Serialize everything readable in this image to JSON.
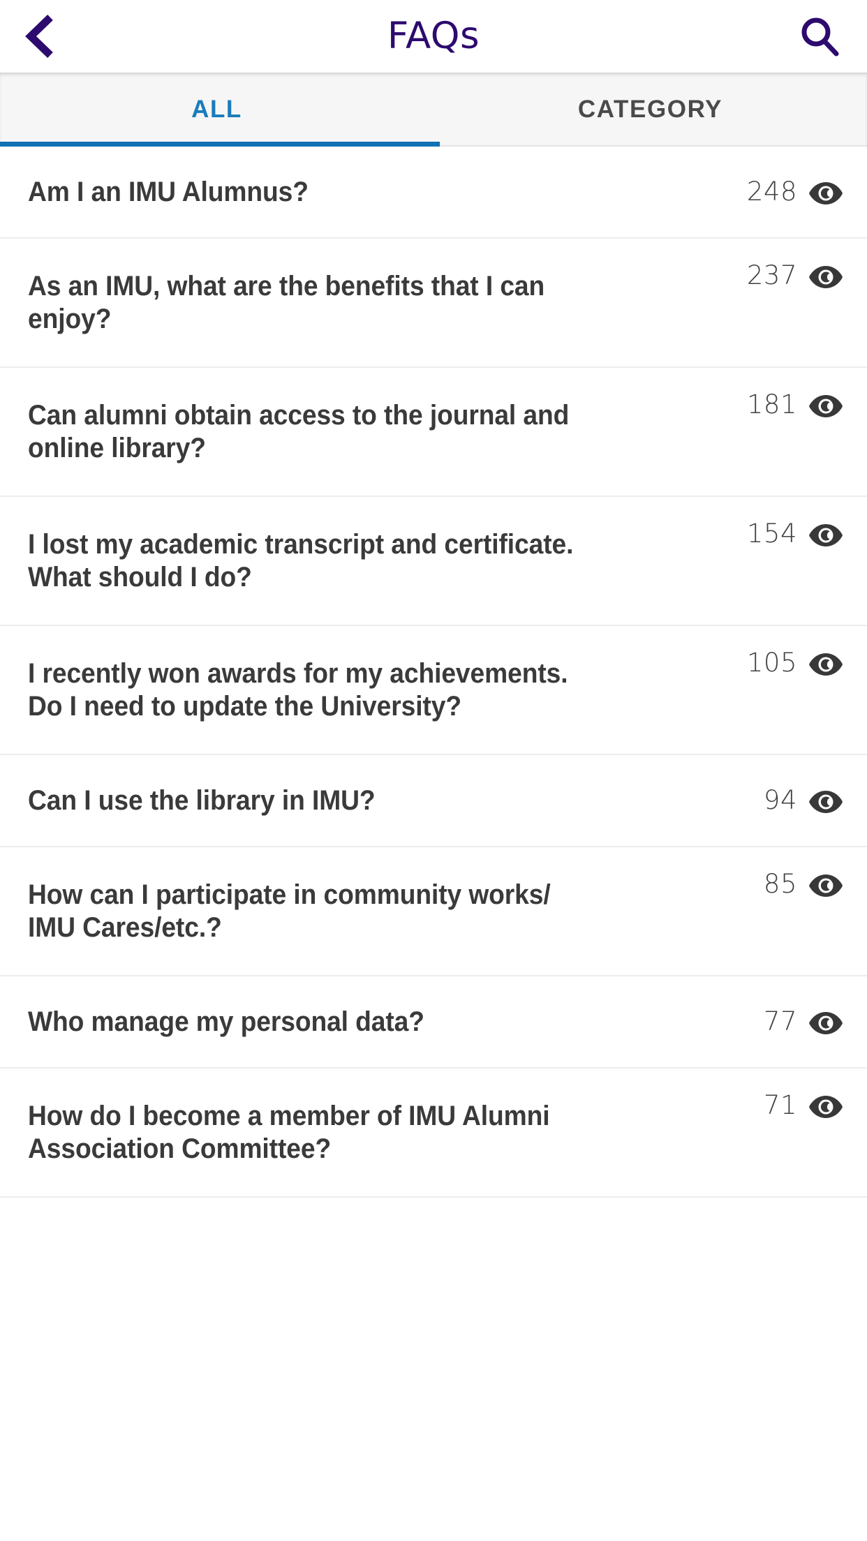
{
  "header": {
    "title": "FAQs",
    "back_icon": "chevron-left-icon",
    "search_icon": "search-icon",
    "title_color": "#2d0a6e"
  },
  "tabs": {
    "active_index": 0,
    "accent_color": "#1072b5",
    "items": [
      {
        "label": "ALL"
      },
      {
        "label": "CATEGORY"
      }
    ]
  },
  "list": {
    "view_icon": "eye-icon",
    "items": [
      {
        "question": "Am I an IMU Alumnus?",
        "views": "248",
        "lines": 1
      },
      {
        "question": "As an IMU, what are the benefits that I can enjoy?",
        "views": "237",
        "lines": 2
      },
      {
        "question": "Can alumni obtain access to the journal and online library?",
        "views": "181",
        "lines": 2
      },
      {
        "question": "I lost my academic transcript and certificate. What should I do?",
        "views": "154",
        "lines": 2
      },
      {
        "question": "I recently won awards for my achievements. Do I need to update the University?",
        "views": "105",
        "lines": 2
      },
      {
        "question": "Can I use the library in IMU?",
        "views": "94",
        "lines": 1
      },
      {
        "question": "How can I participate in community works/ IMU Cares/etc.?",
        "views": "85",
        "lines": 2
      },
      {
        "question": "Who manage my personal data?",
        "views": "77",
        "lines": 1
      },
      {
        "question": "How do I become a member of IMU Alumni Association Committee?",
        "views": "71",
        "lines": 2
      }
    ]
  }
}
